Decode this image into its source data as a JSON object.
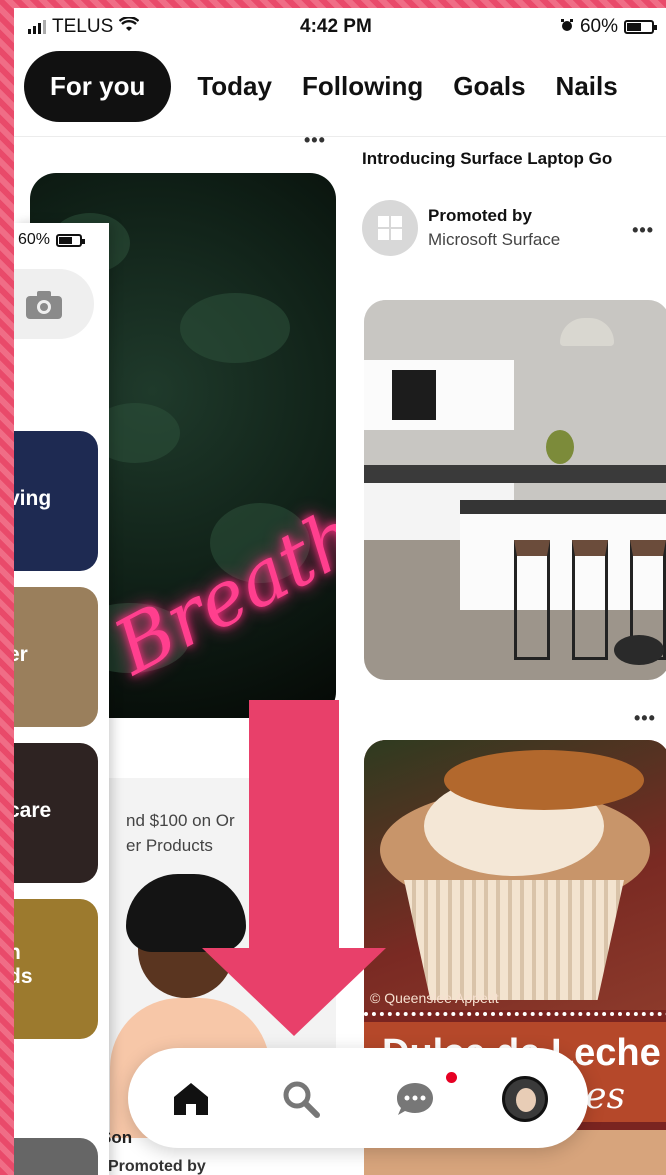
{
  "status_bar": {
    "carrier": "TELUS",
    "time": "4:42 PM",
    "battery": "60%",
    "battery_level": 0.6
  },
  "tabs": [
    {
      "label": "For you",
      "active": true
    },
    {
      "label": "Today",
      "active": false
    },
    {
      "label": "Following",
      "active": false
    },
    {
      "label": "Goals",
      "active": false
    },
    {
      "label": "Nails",
      "active": false
    }
  ],
  "feed": {
    "left_pin": {
      "neon_text": "Breathe"
    },
    "ad_pin": {
      "text_line1": "nd $100 on Or",
      "text_line2": "er Products",
      "caption": "Son",
      "promoted_by": "Promoted by"
    },
    "promo_pin": {
      "title": "Introducing Surface Laptop Go",
      "promoted_by": "Promoted by",
      "advertiser": "Microsoft Surface"
    },
    "cupcake_pin": {
      "credit": "© Queenslee Appetit",
      "banner_line1": "Dulce de Leche",
      "banner_line2": "akes"
    },
    "more_label": "•••"
  },
  "overlay": {
    "battery": "60%",
    "tiles": [
      {
        "label": "ving",
        "color": "#1e2a52"
      },
      {
        "label": "er",
        "color": "#9a7f5c"
      },
      {
        "label": "care",
        "color": "#2e2322"
      },
      {
        "label": "n\nds",
        "color": "#9c7a2e"
      }
    ]
  },
  "colors": {
    "accent_red": "#e60023",
    "tutorial_arrow": "#e8406a",
    "tab_active_bg": "#111111"
  },
  "bottom_nav": {
    "items": [
      "home-icon",
      "search-icon",
      "messages-icon",
      "profile-avatar"
    ]
  }
}
